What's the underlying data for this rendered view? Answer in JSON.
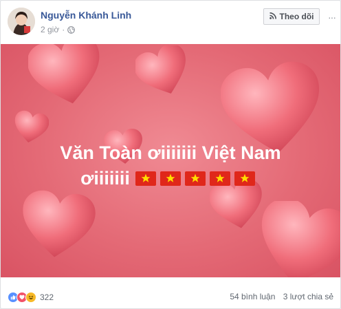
{
  "post": {
    "author": "Nguyễn Khánh Linh",
    "time": "2 giờ",
    "separator": "·",
    "follow_label": "Theo dõi",
    "more_label": "···",
    "image_text_line1": "Văn Toàn ơiiiiiii Việt Nam",
    "image_text_line2": "ơiiiiiii",
    "flag_count": 5,
    "reaction_count": "322",
    "comments": "54 bình luận",
    "shares": "3 lượt chia sẻ"
  },
  "icons": {
    "privacy": "globe-icon",
    "follow": "rss-icon",
    "reactions": [
      "like-icon",
      "love-icon",
      "haha-icon"
    ],
    "flag": "vietnam-flag-icon"
  },
  "colors": {
    "author": "#385898",
    "image_bg": "#e46a76",
    "flag_red": "#e0271a",
    "flag_star": "#ffde00"
  }
}
